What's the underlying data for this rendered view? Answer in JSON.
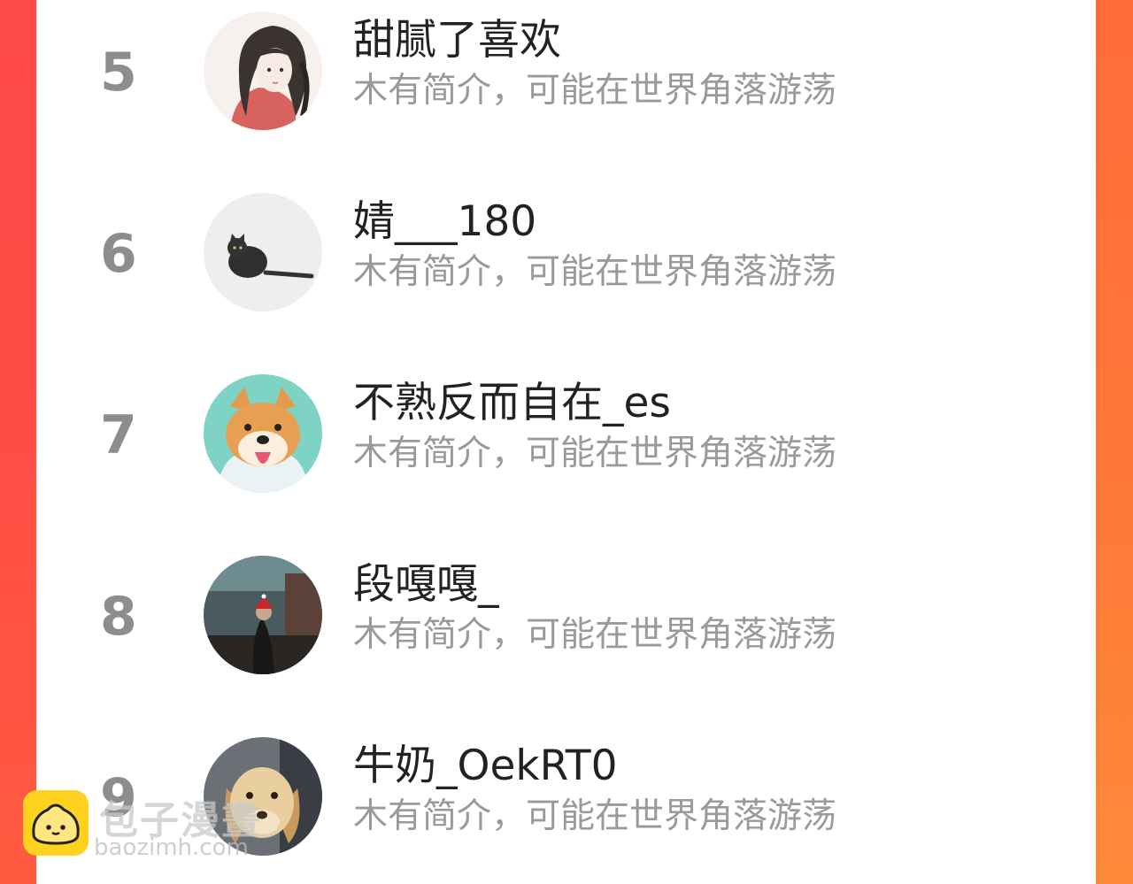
{
  "ranking_list": [
    {
      "rank": "5",
      "name": "甜腻了喜欢",
      "bio": "木有简介，可能在世界角落游荡",
      "avatar": "anime-girl-avatar"
    },
    {
      "rank": "6",
      "name": "婧___180",
      "bio": "木有简介，可能在世界角落游荡",
      "avatar": "black-cat-avatar"
    },
    {
      "rank": "7",
      "name": "不熟反而自在_es",
      "bio": "木有简介，可能在世界角落游荡",
      "avatar": "shiba-dog-avatar"
    },
    {
      "rank": "8",
      "name": "段嘎嘎_",
      "bio": "木有简介，可能在世界角落游荡",
      "avatar": "person-photo-avatar"
    },
    {
      "rank": "9",
      "name": "牛奶_OekRT0",
      "bio": "木有简介，可能在世界角落游荡",
      "avatar": "golden-puppy-avatar"
    }
  ],
  "watermark": {
    "title": "包子漫畫",
    "url": "baozimh.com"
  },
  "colors": {
    "side_left": "#ff4a47",
    "side_right": "#ff7a3a",
    "rank": "#8d8d8d",
    "name": "#222222",
    "bio": "#9a9a9a",
    "logo": "#ffd21f"
  }
}
